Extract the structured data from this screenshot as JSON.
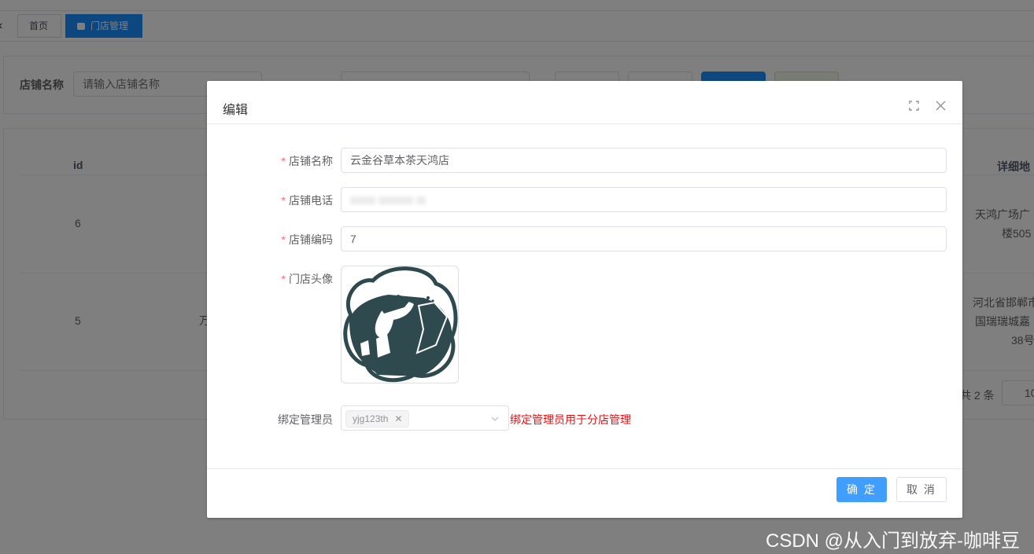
{
  "tabs": {
    "home_label": "首页",
    "active_label": "门店管理"
  },
  "search": {
    "store_name_label": "店铺名称",
    "store_name_placeholder": "请输入店铺名称"
  },
  "table": {
    "columns": {
      "id": "id",
      "address": "详细地"
    },
    "rows": [
      {
        "id": "6",
        "address_lines": [
          "天鸿广场广",
          "楼505"
        ]
      },
      {
        "id": "5",
        "col2_fragment": "万",
        "address_lines": [
          "河北省邯郸市",
          "国瑞瑞城嘉",
          "38号"
        ]
      }
    ],
    "pager_total": "共 2 条",
    "pager_size": "10"
  },
  "dialog": {
    "title": "编辑",
    "fields": {
      "store_name": {
        "label": "店铺名称",
        "value": "云金谷草本茶天鸿店"
      },
      "store_phone": {
        "label": "店铺电话"
      },
      "store_code": {
        "label": "店铺编码",
        "value": "7"
      },
      "store_avatar": {
        "label": "门店头像"
      },
      "admin": {
        "label": "绑定管理员",
        "tag": "yjg123th",
        "hint": "绑定管理员用于分店管理"
      }
    },
    "buttons": {
      "ok": "确 定",
      "cancel": "取 消"
    }
  },
  "watermark": "CSDN @从入门到放弃-咖啡豆",
  "colors": {
    "primary": "#409eff",
    "required": "#f56c6c",
    "hint": "#f20d0d",
    "avatar": "#2f4a4f"
  }
}
